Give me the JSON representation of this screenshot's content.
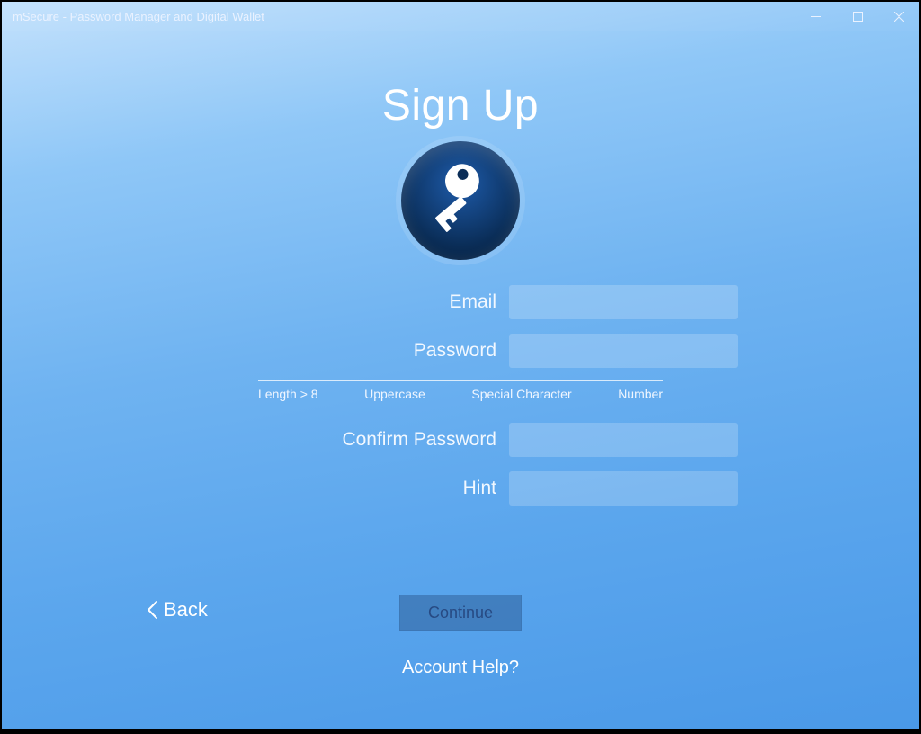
{
  "window": {
    "title": "mSecure - Password Manager and Digital Wallet"
  },
  "heading": "Sign Up",
  "form": {
    "email": {
      "label": "Email",
      "value": ""
    },
    "password": {
      "label": "Password",
      "value": ""
    },
    "confirm_password": {
      "label": "Confirm Password",
      "value": ""
    },
    "hint": {
      "label": "Hint",
      "value": ""
    }
  },
  "password_requirements": {
    "length": "Length > 8",
    "upper": "Uppercase",
    "special": "Special Character",
    "number": "Number"
  },
  "actions": {
    "back": "Back",
    "continue": "Continue",
    "help": "Account Help?"
  }
}
